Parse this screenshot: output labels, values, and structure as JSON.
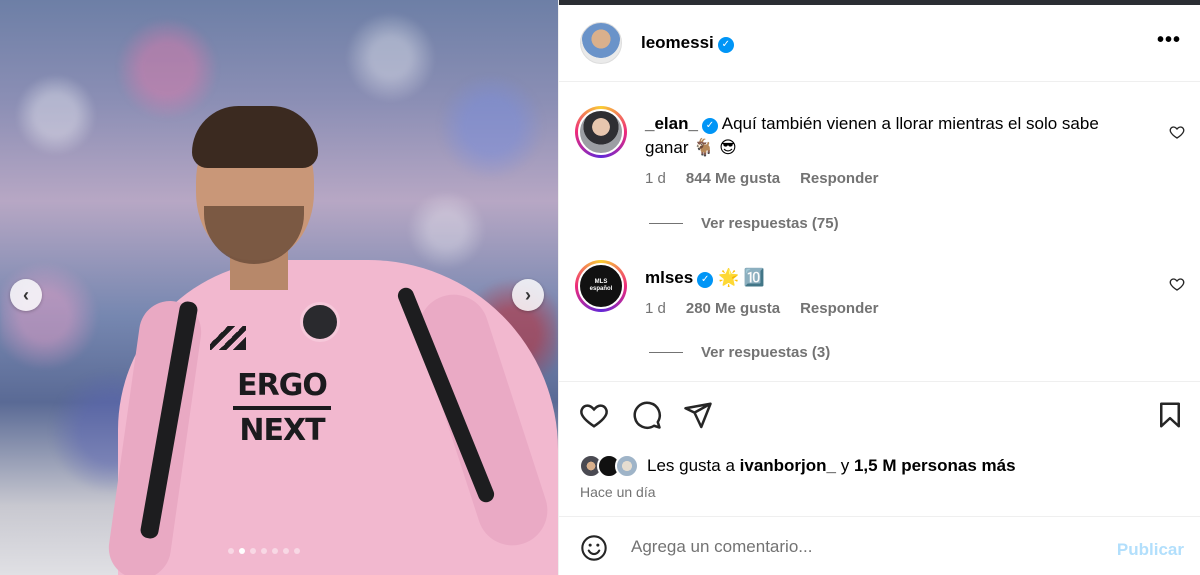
{
  "post": {
    "media": {
      "sponsor_line1": "ERGO",
      "sponsor_line2": "NEXT",
      "carousel_dots": 7,
      "active_dot": 1
    },
    "header": {
      "username": "leomessi",
      "verified": true,
      "more_icon": "more-horizontal-icon"
    },
    "comments": [
      {
        "username": "_elan_",
        "verified": true,
        "text": "Aquí también vienen a llorar mientras el solo sabe ganar 🐐 😎",
        "time": "1 d",
        "likes": "844 Me gusta",
        "reply_label": "Responder",
        "view_replies": "Ver respuestas (75)"
      },
      {
        "username": "mlses",
        "verified": true,
        "text": "🌟 🔟",
        "time": "1 d",
        "likes": "280 Me gusta",
        "reply_label": "Responder",
        "view_replies": "Ver respuestas (3)",
        "avatar_text": "MLS español"
      }
    ],
    "actions": {
      "liked_by_prefix": "Les gusta a",
      "liked_by_user": "ivanborjon_",
      "liked_by_joiner": "y",
      "liked_by_rest": "1,5 M personas más",
      "time_ago": "Hace un día"
    },
    "add_comment": {
      "placeholder": "Agrega un comentario...",
      "post_label": "Publicar"
    },
    "colors": {
      "verified": "#0095f6",
      "secondary_text": "#737373",
      "post_button_disabled": "#b2dffc"
    }
  }
}
